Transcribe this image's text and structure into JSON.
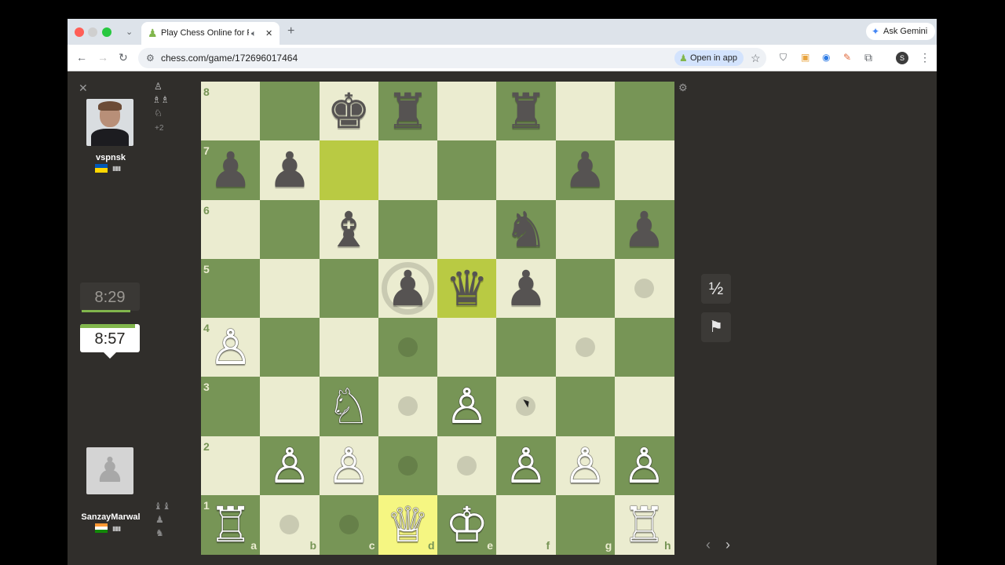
{
  "browser": {
    "tab_title": "Play Chess Online for FREE",
    "new_tab": "+",
    "url": "chess.com/game/172696017464",
    "open_in_app": "Open in app",
    "ask_gemini": "Ask Gemini",
    "profile_initial": "S",
    "icons": [
      "back-icon",
      "forward-icon",
      "reload-icon",
      "site-info-icon",
      "bookmark-star-icon",
      "extensions-icon",
      "menu-icon"
    ]
  },
  "opponent": {
    "name": "vspnsk",
    "clock": "8:29",
    "captured_extra": "+2",
    "flag_colors": [
      "#0057b7",
      "#ffd700"
    ]
  },
  "player": {
    "name": "SanzayMarwal",
    "clock": "8:57",
    "flag_colors": [
      "#ff9933",
      "#ffffff",
      "#138808"
    ]
  },
  "colors": {
    "light": "#ebecd0",
    "dark": "#779556",
    "highlight_light": "#f5f682",
    "highlight_dark": "#b9ca43"
  },
  "board": {
    "files": [
      "a",
      "b",
      "c",
      "d",
      "e",
      "f",
      "g",
      "h"
    ],
    "ranks": [
      "8",
      "7",
      "6",
      "5",
      "4",
      "3",
      "2",
      "1"
    ],
    "pieces": [
      {
        "sq": "c8",
        "glyph": "♚",
        "color": "black"
      },
      {
        "sq": "d8",
        "glyph": "♜",
        "color": "black"
      },
      {
        "sq": "f8",
        "glyph": "♜",
        "color": "black"
      },
      {
        "sq": "a7",
        "glyph": "♟",
        "color": "black"
      },
      {
        "sq": "b7",
        "glyph": "♟",
        "color": "black"
      },
      {
        "sq": "g7",
        "glyph": "♟",
        "color": "black"
      },
      {
        "sq": "c6",
        "glyph": "♝",
        "color": "black"
      },
      {
        "sq": "f6",
        "glyph": "♞",
        "color": "black"
      },
      {
        "sq": "h6",
        "glyph": "♟",
        "color": "black"
      },
      {
        "sq": "d5",
        "glyph": "♟",
        "color": "black"
      },
      {
        "sq": "e5",
        "glyph": "♛",
        "color": "black"
      },
      {
        "sq": "f5",
        "glyph": "♟",
        "color": "black"
      },
      {
        "sq": "a4",
        "glyph": "♙",
        "color": "white"
      },
      {
        "sq": "c3",
        "glyph": "♘",
        "color": "white"
      },
      {
        "sq": "e3",
        "glyph": "♙",
        "color": "white"
      },
      {
        "sq": "b2",
        "glyph": "♙",
        "color": "white"
      },
      {
        "sq": "c2",
        "glyph": "♙",
        "color": "white"
      },
      {
        "sq": "f2",
        "glyph": "♙",
        "color": "white"
      },
      {
        "sq": "g2",
        "glyph": "♙",
        "color": "white"
      },
      {
        "sq": "h2",
        "glyph": "♙",
        "color": "white"
      },
      {
        "sq": "a1",
        "glyph": "♖",
        "color": "white"
      },
      {
        "sq": "d1",
        "glyph": "♕",
        "color": "white"
      },
      {
        "sq": "e1",
        "glyph": "♔",
        "color": "white"
      },
      {
        "sq": "h1",
        "glyph": "♖",
        "color": "white"
      }
    ],
    "highlighted": [
      "c7",
      "e5"
    ],
    "selected": "d1",
    "move_dots": [
      "h5",
      "d4",
      "g4",
      "d3",
      "f3",
      "d2",
      "e2",
      "b1",
      "c1"
    ],
    "capture_rings": [
      "d5"
    ]
  },
  "controls": {
    "draw_label": "½",
    "resign_icon": "flag-icon",
    "close": "✕"
  }
}
